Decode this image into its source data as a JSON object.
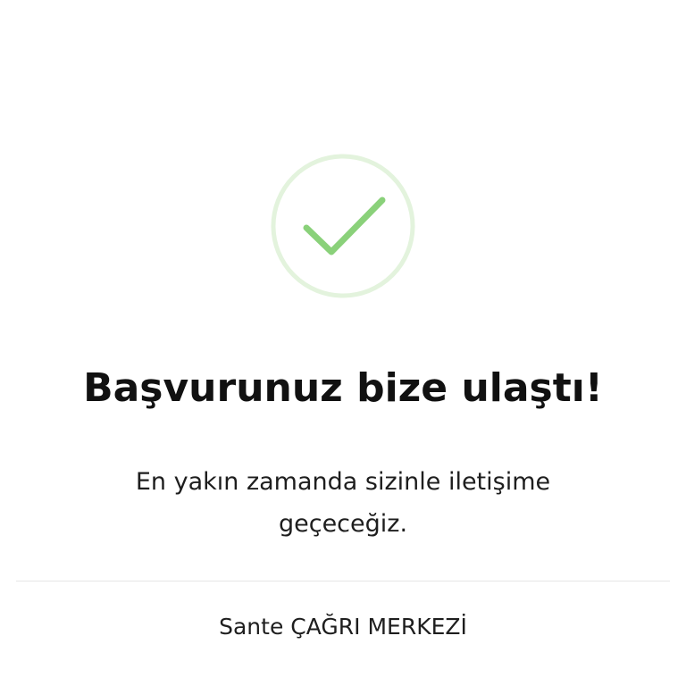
{
  "icon": {
    "name": "check-circle-icon",
    "ring_color": "#e3f3dd",
    "check_color": "#8ad17a"
  },
  "title": "Başvurunuz bize ulaştı!",
  "message_lines": [
    "En yakın zamanda sizinle iletişime",
    "geçeceğiz."
  ],
  "call_center_label": "Sante ÇAĞRI MERKEZİ"
}
